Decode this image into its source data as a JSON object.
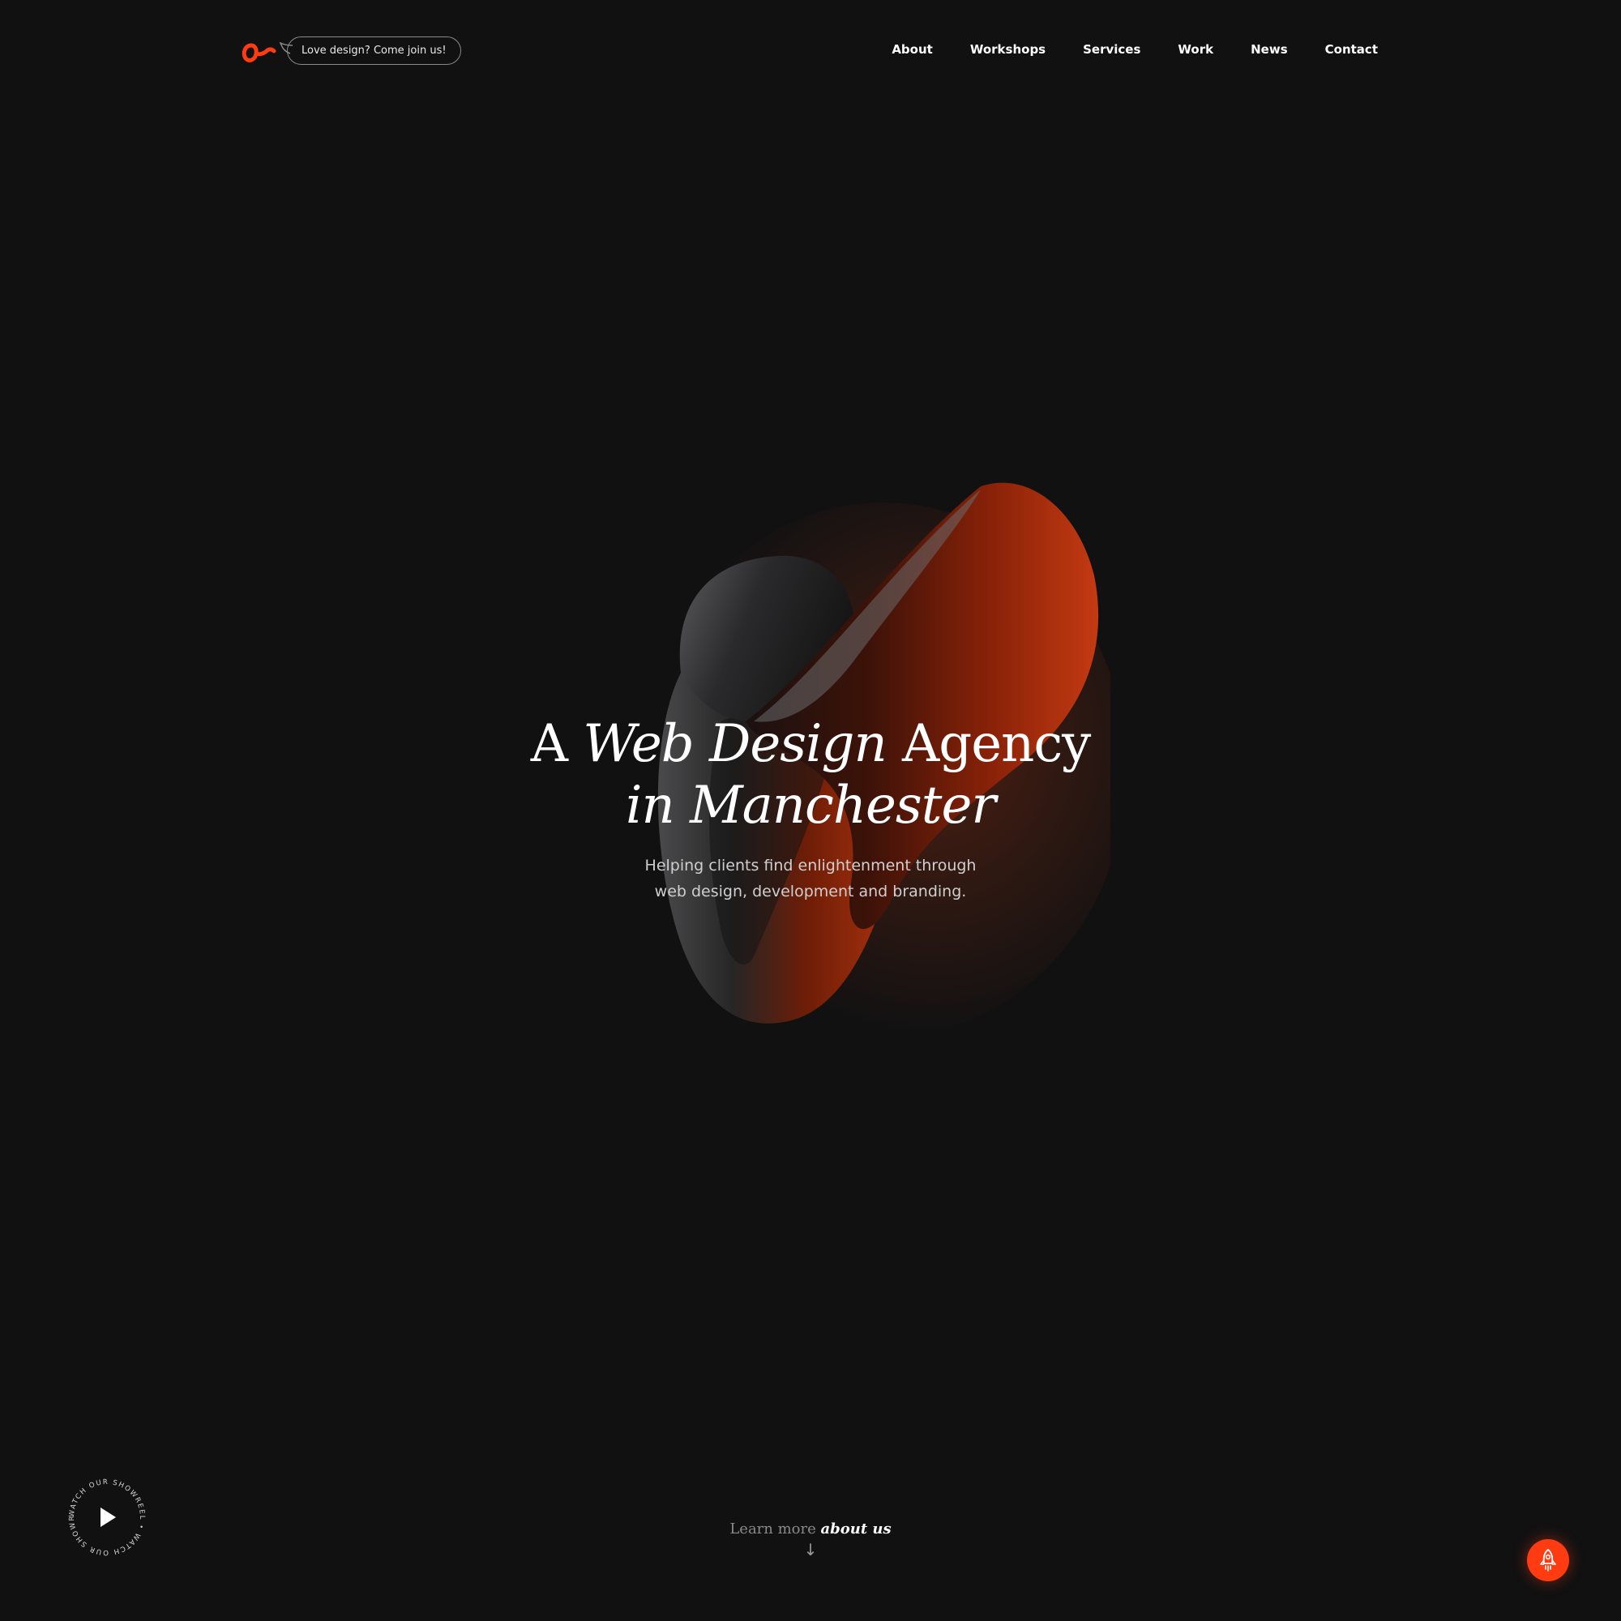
{
  "header": {
    "logo_icon": "agency-logo-mark",
    "pill_text": "Love design? Come join us!"
  },
  "nav": {
    "items": [
      "About",
      "Workshops",
      "Services",
      "Work",
      "News",
      "Contact"
    ]
  },
  "hero": {
    "headline_a": "A",
    "headline_em": "Web Design",
    "headline_agency": "Agency",
    "headline_line2": "in Manchester",
    "sub_line1": "Helping clients find enlightenment through",
    "sub_line2": "web design, development and branding."
  },
  "showreel": {
    "ring_text": "WATCH OUR SHOWREEL • WATCH OUR SHOWREEL •",
    "icon": "play-icon"
  },
  "learn_more": {
    "prefix": "Learn more",
    "emphasis": "about us",
    "arrow": "↓"
  },
  "fab": {
    "icon": "rocket-icon"
  },
  "colors": {
    "background": "#111112",
    "accent": "#ff3b12",
    "text": "#ffffff",
    "muted": "#8a8a8a"
  }
}
